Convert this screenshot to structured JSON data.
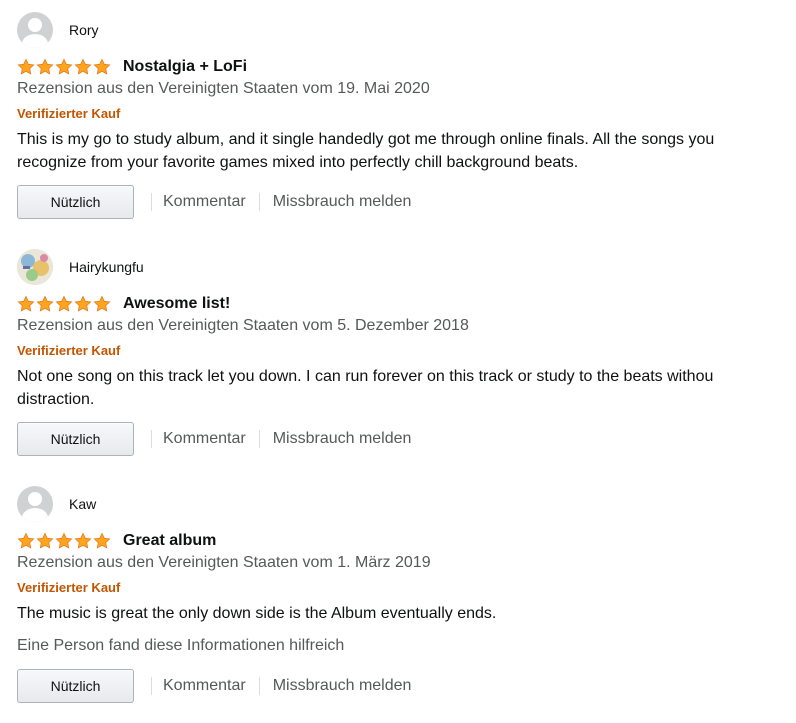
{
  "colors": {
    "verified": "#c45500",
    "star": "#ffa41c",
    "muted": "#565959"
  },
  "reviews": [
    {
      "author": "Rory",
      "avatar": "default-avatar",
      "rating": 5,
      "title": "Nostalgia + LoFi",
      "meta": "Rezension aus den Vereinigten Staaten vom 19. Mai 2020",
      "verified": "Verifizierter Kauf",
      "body": "This is my go to study album, and it single handedly got me through online finals. All the songs you recognize from your favorite games mixed into perfectly chill background beats.",
      "helpful": "",
      "helpful_button": "Nützlich",
      "comment_link": "Kommentar",
      "report_link": "Missbrauch melden"
    },
    {
      "author": "Hairykungfu",
      "avatar": "custom-avatar",
      "rating": 5,
      "title": "Awesome list!",
      "meta": "Rezension aus den Vereinigten Staaten vom 5. Dezember 2018",
      "verified": "Verifizierter Kauf",
      "body": "Not one song on this track let you down. I can run forever on this track or study to the beats withou distraction.",
      "helpful": "",
      "helpful_button": "Nützlich",
      "comment_link": "Kommentar",
      "report_link": "Missbrauch melden"
    },
    {
      "author": "Kaw",
      "avatar": "default-avatar",
      "rating": 5,
      "title": "Great album",
      "meta": "Rezension aus den Vereinigten Staaten vom 1. März 2019",
      "verified": "Verifizierter Kauf",
      "body": "The music is great the only down side is the Album eventually ends.",
      "helpful": "Eine Person fand diese Informationen hilfreich",
      "helpful_button": "Nützlich",
      "comment_link": "Kommentar",
      "report_link": "Missbrauch melden"
    }
  ]
}
